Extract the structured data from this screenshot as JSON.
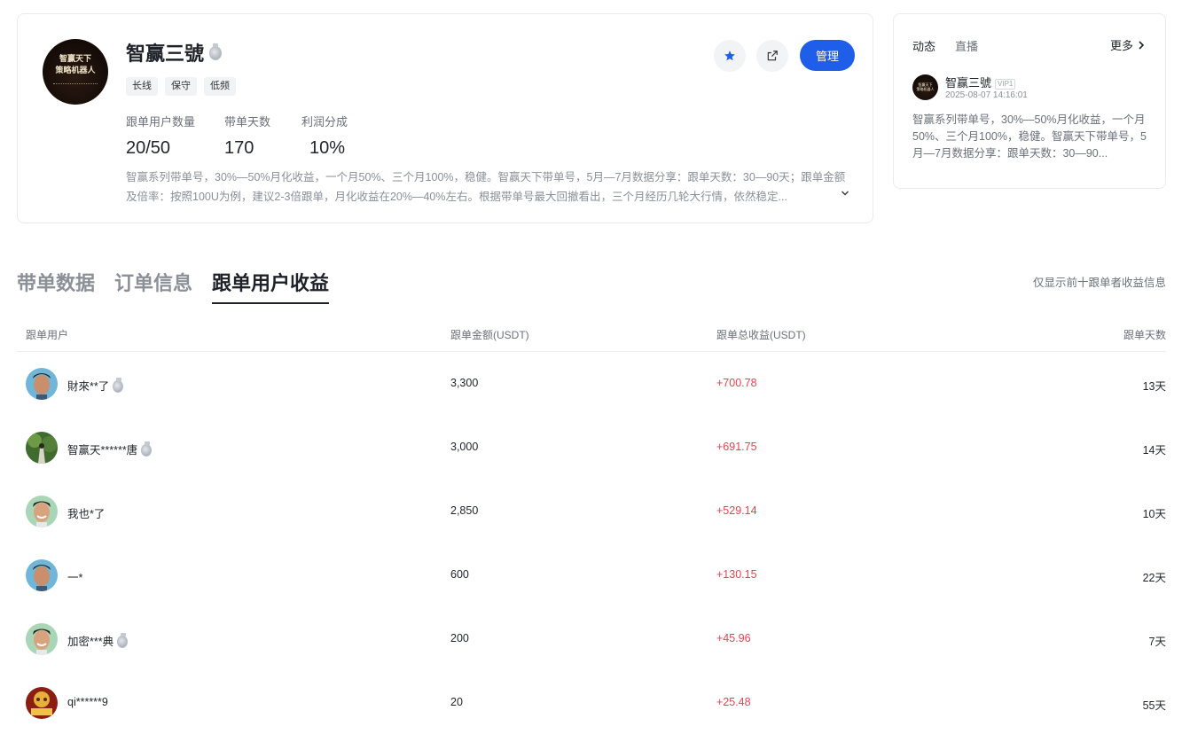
{
  "profile": {
    "avatar_lines": [
      "智赢天下",
      "策略机器人"
    ],
    "name": "智赢三號",
    "tags": [
      "长线",
      "保守",
      "低频"
    ],
    "stats": [
      {
        "label": "跟单用户数量",
        "value": "20/50"
      },
      {
        "label": "带单天数",
        "value": "170"
      },
      {
        "label": "利润分成",
        "value": "10%"
      }
    ],
    "description": "智赢系列带单号，30%—50%月化收益，一个月50%、三个月100%，稳健。智赢天下带单号，5月—7月数据分享：跟单天数：30—90天；跟单金额及倍率：按照100U为例，建议2-3倍跟单，月化收益在20%—40%左右。根据带单号最大回撤看出，三个月经历几轮大行情，依然稳定...",
    "manage_label": "管理",
    "star_icon": "star-icon",
    "share_icon": "share-icon",
    "accent_color": "#1f5ee8"
  },
  "feed": {
    "tabs": [
      "动态",
      "直播"
    ],
    "more_label": "更多",
    "author": "智赢三號",
    "vip_label": "VIP1",
    "time": "2025-08-07 14:16:01",
    "text": "智赢系列带单号，30%—50%月化收益，一个月50%、三个月100%，稳健。智赢天下带单号，5月—7月数据分享：跟单天数：30—90..."
  },
  "main_tabs": [
    "带单数据",
    "订单信息",
    "跟单用户收益"
  ],
  "active_tab": "跟单用户收益",
  "note": "仅显示前十跟单者收益信息",
  "table": {
    "headers": [
      "跟单用户",
      "跟单金额(USDT)",
      "跟单总收益(USDT)",
      "跟单天数"
    ],
    "profit_color": "#e64253",
    "rows": [
      {
        "user": "財來**了",
        "medal": true,
        "amount": "3,300",
        "profit": "+700.78",
        "days": "13天"
      },
      {
        "user": "智赢天******唐",
        "medal": true,
        "amount": "3,000",
        "profit": "+691.75",
        "days": "14天"
      },
      {
        "user": "我也*了",
        "medal": false,
        "amount": "2,850",
        "profit": "+529.14",
        "days": "10天"
      },
      {
        "user": "一*",
        "medal": false,
        "amount": "600",
        "profit": "+130.15",
        "days": "22天"
      },
      {
        "user": "加密***典",
        "medal": true,
        "amount": "200",
        "profit": "+45.96",
        "days": "7天"
      },
      {
        "user": "qi******9",
        "medal": false,
        "amount": "20",
        "profit": "+25.48",
        "days": "55天"
      }
    ]
  }
}
